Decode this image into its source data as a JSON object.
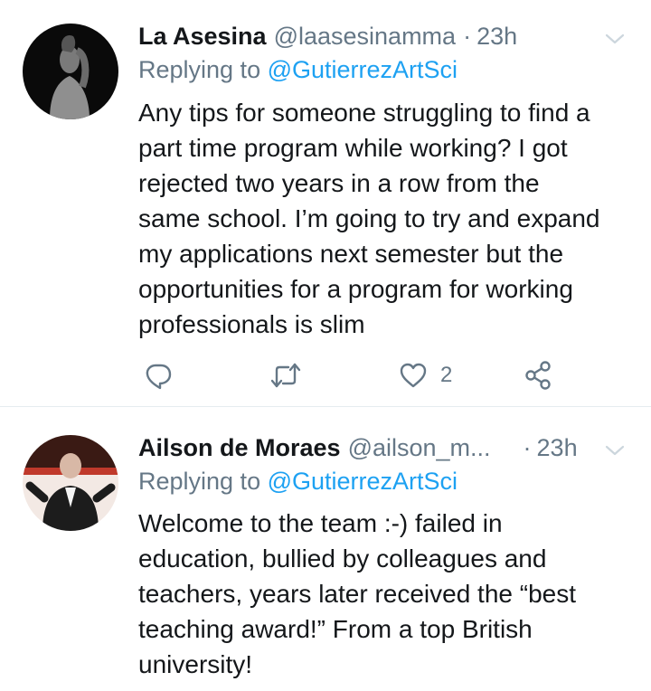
{
  "tweets": [
    {
      "avatar_icon": "profile-photo",
      "display_name": "La Asesina",
      "handle": "@laasesinamma",
      "separator": "·",
      "time": "23h",
      "replying_prefix": "Replying to",
      "replying_to": "@GutierrezArtSci",
      "text": "Any tips for someone struggling to find a\npart time program while working? I got\nrejected two years in a row from the\nsame school. I’m going to try and expand\nmy applications next semester but the\nopportunities for a program for working\nprofessionals is slim",
      "actions": {
        "reply_icon": "reply-icon",
        "retweet_icon": "retweet-icon",
        "like_icon": "heart-icon",
        "like_count": "2",
        "share_icon": "share-icon"
      }
    },
    {
      "avatar_icon": "profile-photo",
      "display_name": "Ailson de Moraes",
      "handle": "@ailson_m...",
      "separator": "·",
      "time": "23h",
      "replying_prefix": "Replying to",
      "replying_to": "@GutierrezArtSci",
      "text": "Welcome to the team :-) failed in\neducation, bullied by colleagues and\nteachers, years later received the “best\nteaching award!” From a top British\nuniversity!"
    }
  ],
  "colors": {
    "accent": "#1da1f2",
    "muted": "#657786",
    "text": "#14171a",
    "divider": "#e6ecf0"
  }
}
